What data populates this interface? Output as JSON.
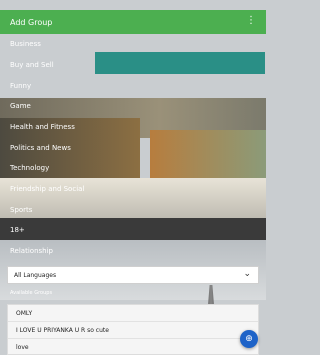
{
  "appbar": {
    "title": "Add Group",
    "menu_icon": "more-vert-icon"
  },
  "categories": [
    "Business",
    "Buy and Sell",
    "Funny",
    "Game",
    "Health and Fitness",
    "Politics and News",
    "Technology",
    "Friendship and Social",
    "Sports",
    "18+",
    "Relationship"
  ],
  "language_select": {
    "value": "All Languages"
  },
  "available_groups": {
    "label": "Available Groups",
    "items": [
      "OMLY",
      "I LOVE U PRIYANKA U R so cute",
      "love"
    ]
  },
  "fab": {
    "icon": "add-group-icon"
  },
  "colors": {
    "appbar": "#4caf50",
    "fab": "#1e63c8"
  }
}
